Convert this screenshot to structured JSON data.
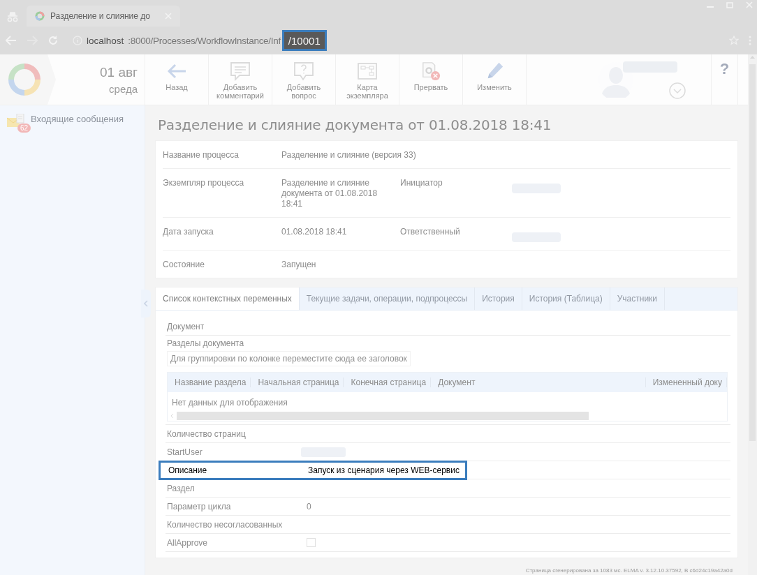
{
  "browser": {
    "tab_title": "Разделение и слияние до",
    "url_host": "localhost",
    "url_path": ":8000/Processes/WorkflowInstance/Inf",
    "url_tail": "/10001",
    "url_tail_highlighted": true
  },
  "header": {
    "date": "01 авг",
    "weekday": "среда",
    "toolbar": [
      {
        "kind": "back",
        "label": "Назад"
      },
      {
        "kind": "comment",
        "label": "Добавить комментарий"
      },
      {
        "kind": "question",
        "label": "Добавить вопрос"
      },
      {
        "kind": "map",
        "label": "Карта экземпляра"
      },
      {
        "kind": "stop",
        "label": "Прервать"
      },
      {
        "kind": "edit",
        "label": "Изменить"
      }
    ],
    "help": "?"
  },
  "sidebar": {
    "items": [
      {
        "label": "Входящие сообщения",
        "badge": "62"
      }
    ]
  },
  "page_title": "Разделение и слияние документа от 01.08.2018 18:41",
  "info_rows": [
    {
      "label": "Название процесса",
      "value": "Разделение и слияние (версия 33)"
    },
    {
      "label": "Экземпляр процесса",
      "value": "Разделение и слияние документа от 01.08.2018 18:41",
      "side_label": "Инициатор",
      "side_blurred": true
    },
    {
      "label": "Дата запуска",
      "value": "01.08.2018 18:41",
      "side_label": "Ответственный",
      "side_blurred": true
    },
    {
      "label": "Состояние",
      "value": "Запущен"
    }
  ],
  "tabs": [
    {
      "label": "Список контекстных переменных",
      "selected": true
    },
    {
      "label": "Текущие задачи, операции, подпроцессы",
      "selected": false
    },
    {
      "label": "История",
      "selected": false
    },
    {
      "label": "История (Таблица)",
      "selected": false
    },
    {
      "label": "Участники",
      "selected": false
    }
  ],
  "variables": [
    {
      "kind": "text",
      "label": "Документ",
      "highlighted": false
    },
    {
      "kind": "grid",
      "label": "Разделы документа",
      "group_hint": "Для группировки по колонке переместите сюда ее заголовок",
      "columns": [
        "Название раздела",
        "Начальная страница",
        "Конечная страница",
        "Документ",
        "Измененный доку"
      ],
      "empty_text": "Нет данных для отображения"
    },
    {
      "kind": "text",
      "label": "Количество страниц",
      "highlighted": false
    },
    {
      "kind": "user",
      "label": "StartUser",
      "blurred": true
    },
    {
      "kind": "text",
      "label": "Описание",
      "value": "Запуск из сценария через WEB-сервис",
      "highlighted": true
    },
    {
      "kind": "text",
      "label": "Раздел",
      "highlighted": false
    },
    {
      "kind": "text",
      "label": "Параметр цикла",
      "value": "0",
      "highlighted": false
    },
    {
      "kind": "text",
      "label": "Количество несогласованных",
      "highlighted": false
    },
    {
      "kind": "checkbox",
      "label": "AllApprove",
      "checked": false
    }
  ],
  "footer": "Страница сгенерирована за 1083 мс. ELMA v. 3.12.10.37592, B c6d24c19a42a0d"
}
